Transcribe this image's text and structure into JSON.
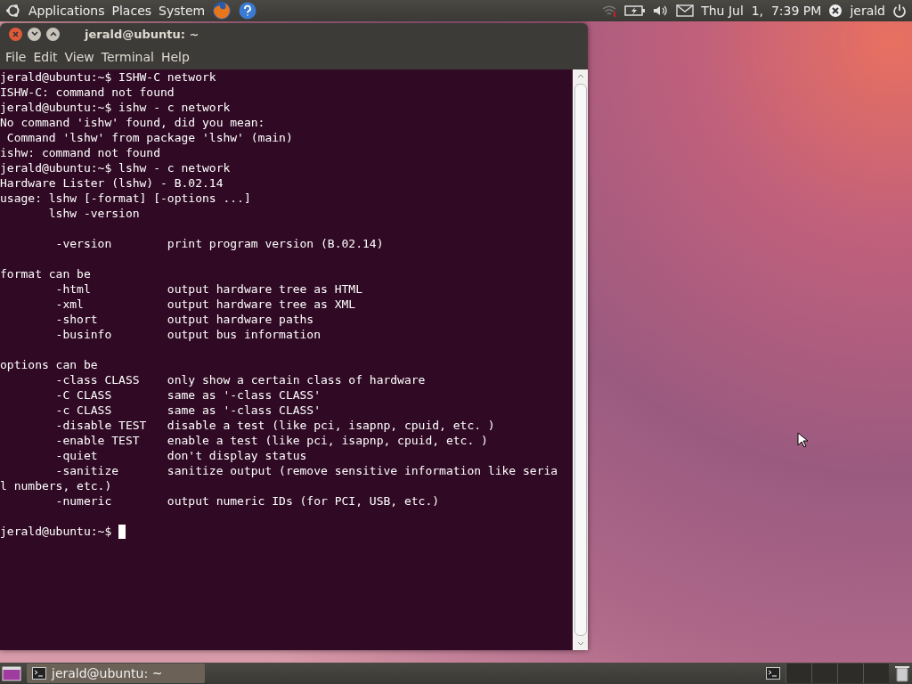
{
  "top_panel": {
    "menus": [
      "Applications",
      "Places",
      "System"
    ],
    "clock": "Thu Jul  1,  7:39 PM",
    "user": "jerald"
  },
  "window": {
    "title": "jerald@ubuntu: ~",
    "menu": [
      "File",
      "Edit",
      "View",
      "Terminal",
      "Help"
    ]
  },
  "terminal": {
    "blocks": [
      [
        "jerald@ubuntu:~$ ISHW-C network",
        "ISHW-C: command not found",
        "jerald@ubuntu:~$ ishw - c network",
        "No command 'ishw' found, did you mean:",
        " Command 'lshw' from package 'lshw' (main)",
        "ishw: command not found",
        "jerald@ubuntu:~$ lshw - c network",
        "Hardware Lister (lshw) - B.02.14",
        "usage: lshw [-format] [-options ...]",
        "       lshw -version"
      ],
      [
        "        -version        print program version (B.02.14)"
      ],
      [
        "format can be",
        "        -html           output hardware tree as HTML",
        "        -xml            output hardware tree as XML",
        "        -short          output hardware paths",
        "        -businfo        output bus information"
      ],
      [
        "options can be",
        "        -class CLASS    only show a certain class of hardware",
        "        -C CLASS        same as '-class CLASS'",
        "        -c CLASS        same as '-class CLASS'",
        "        -disable TEST   disable a test (like pci, isapnp, cpuid, etc. )",
        "        -enable TEST    enable a test (like pci, isapnp, cpuid, etc. )",
        "        -quiet          don't display status",
        "        -sanitize       sanitize output (remove sensitive information like seria",
        "l numbers, etc.)",
        "        -numeric        output numeric IDs (for PCI, USB, etc.)"
      ]
    ],
    "prompt": "jerald@ubuntu:~$ "
  },
  "bottom_panel": {
    "task": {
      "label": "jerald@ubuntu: ~",
      "selected": true
    }
  }
}
